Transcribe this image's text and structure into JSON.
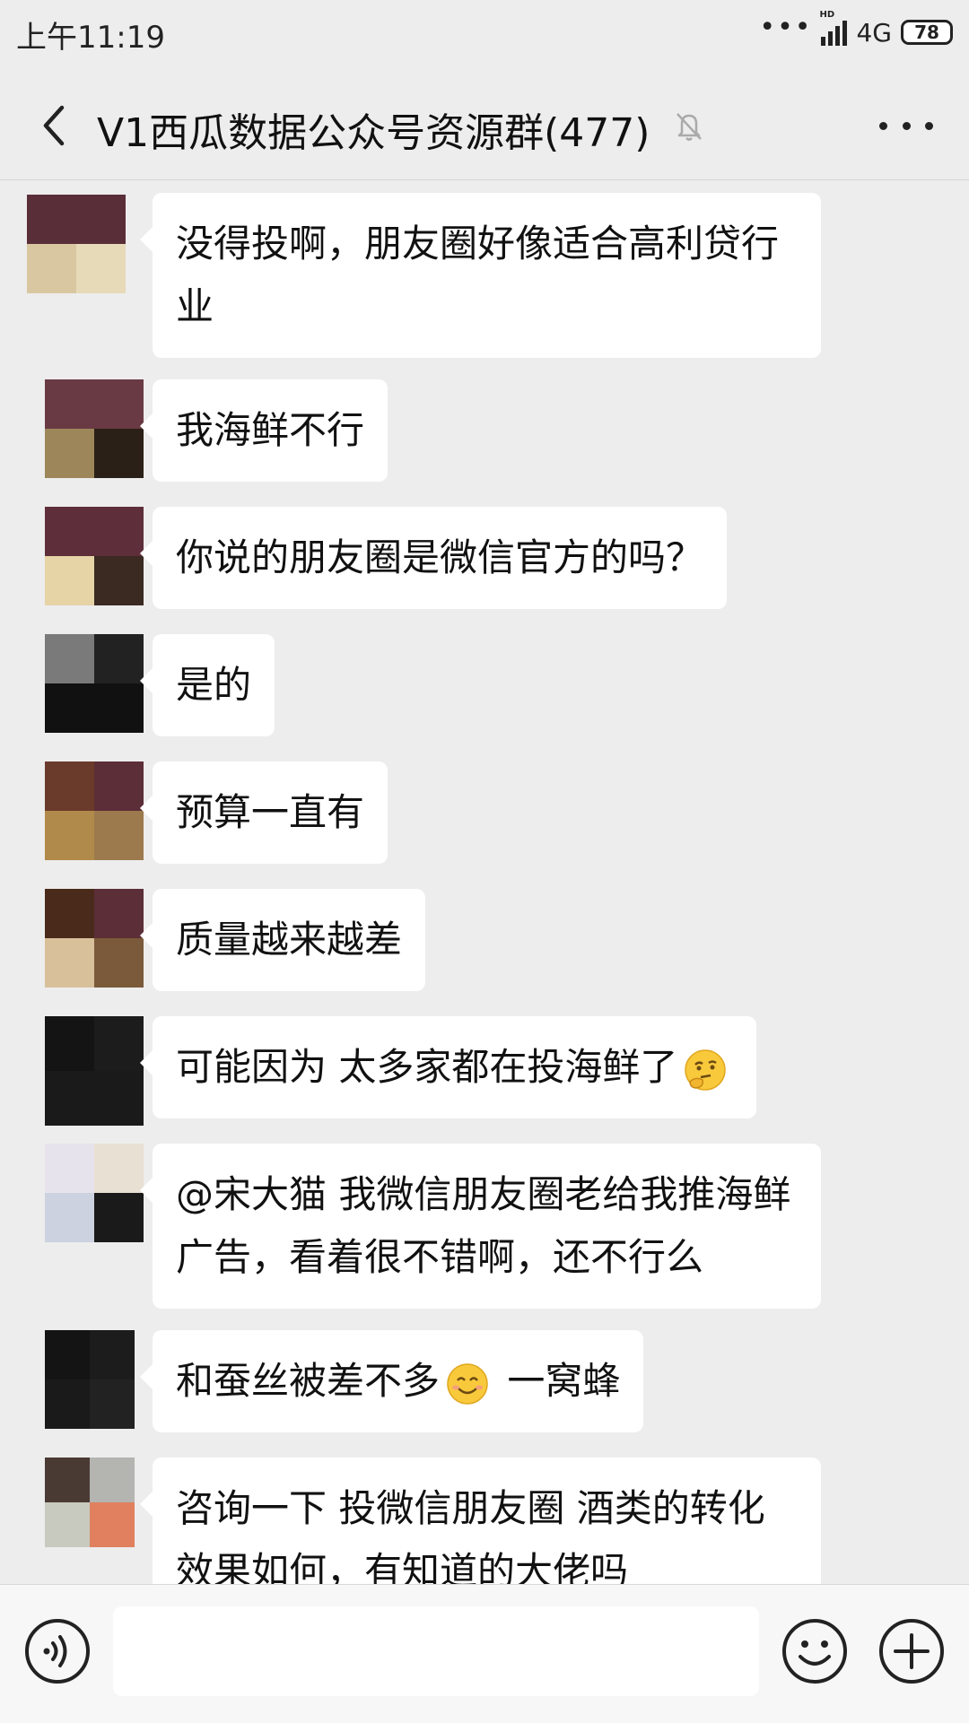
{
  "status_bar": {
    "time": "上午11:19",
    "network": "4G",
    "hd_label": "HD",
    "battery": "78"
  },
  "header": {
    "title": "V1西瓜数据公众号资源群(477)"
  },
  "messages": [
    {
      "text": "没得投啊，朋友圈好像适合高利贷行业",
      "avatar": [
        "#5A2E38",
        "#5A2E38",
        "#D8C7A0",
        "#E7DAB8"
      ]
    },
    {
      "text": "我海鲜不行",
      "avatar": [
        "#6A3A44",
        "#6A3A44",
        "#9C865A",
        "#2A2018"
      ]
    },
    {
      "text": "你说的朋友圈是微信官方的吗？",
      "avatar": [
        "#5E2E3A",
        "#5E2E3A",
        "#E6D3A6",
        "#3A2A22"
      ]
    },
    {
      "text": "是的",
      "avatar": [
        "#7A7A7A",
        "#222222",
        "#111111",
        "#111111"
      ]
    },
    {
      "text": "预算一直有",
      "avatar": [
        "#6A3A2A",
        "#5C2E38",
        "#B08A4A",
        "#9C7A4E"
      ]
    },
    {
      "text": "质量越来越差",
      "avatar": [
        "#4A2A1A",
        "#5C2E38",
        "#D8C09A",
        "#7A5A3A"
      ]
    },
    {
      "text": "可能因为 太多家都在投海鲜了",
      "emoji": "thinking",
      "avatar": [
        "#141414",
        "#1C1C1C",
        "#1A1A1A",
        "#1A1A1A"
      ]
    },
    {
      "text": "@宋大猫 我微信朋友圈老给我推海鲜广告，看着很不错啊，还不行么",
      "avatar": [
        "#E6E3EC",
        "#E8E0D2",
        "#CDD2E0",
        "#1A1A1A"
      ]
    },
    {
      "text_before": "和蚕丝被差不多",
      "emoji": "smile",
      "text_after": " 一窝蜂",
      "avatar": [
        "#141414",
        "#1C1C1C",
        "#1A1A1A",
        "#222222"
      ]
    },
    {
      "text": "咨询一下  投微信朋友圈  酒类的转化效果如何，有知道的大佬吗",
      "avatar": [
        "#4A3A34",
        "#B4B4B0",
        "#C8CAC0",
        "#E0805E"
      ]
    }
  ],
  "input": {
    "value": "",
    "placeholder": ""
  },
  "icons": {
    "back": "back-arrow-icon",
    "mute": "bell-muted-icon",
    "more": "more-dots-icon",
    "voice": "voice-icon",
    "emoji": "emoji-icon",
    "plus": "plus-icon"
  },
  "colors": {
    "background": "#EDEDED",
    "bubble": "#FFFFFF",
    "inputbar": "#F7F7F7"
  }
}
